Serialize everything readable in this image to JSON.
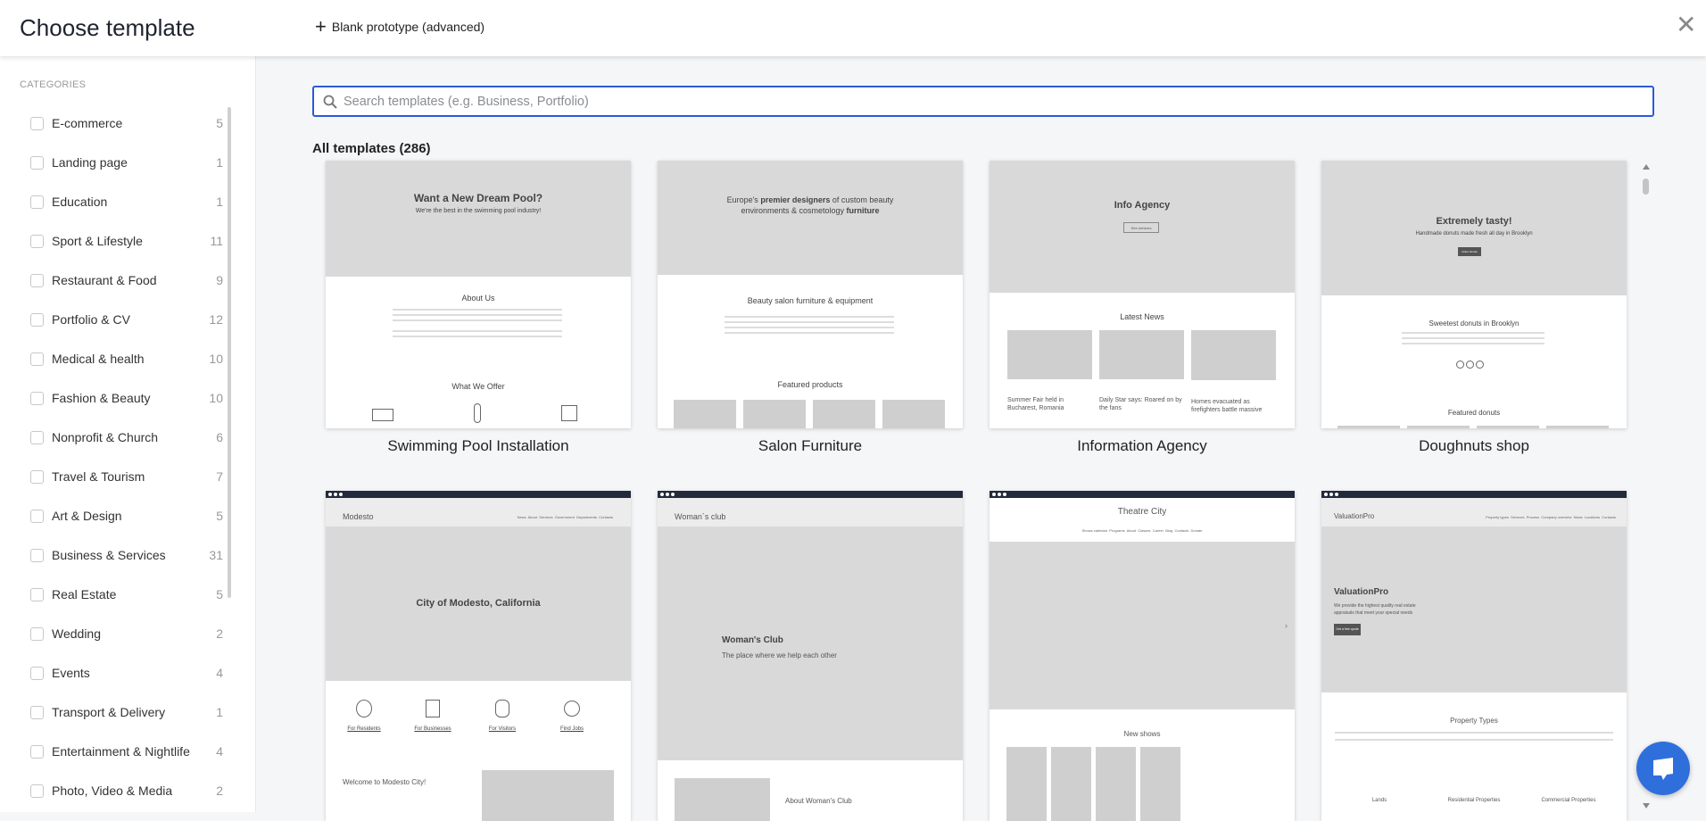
{
  "header": {
    "title": "Choose template",
    "blank_label": "Blank prototype (advanced)",
    "close_icon": "close-icon"
  },
  "sidebar": {
    "heading": "CATEGORIES",
    "items": [
      {
        "label": "E-commerce",
        "count": "5"
      },
      {
        "label": "Landing page",
        "count": "1"
      },
      {
        "label": "Education",
        "count": "1"
      },
      {
        "label": "Sport & Lifestyle",
        "count": "11"
      },
      {
        "label": "Restaurant & Food",
        "count": "9"
      },
      {
        "label": "Portfolio & CV",
        "count": "12"
      },
      {
        "label": "Medical & health",
        "count": "10"
      },
      {
        "label": "Fashion & Beauty",
        "count": "10"
      },
      {
        "label": "Nonprofit & Church",
        "count": "6"
      },
      {
        "label": "Travel & Tourism",
        "count": "7"
      },
      {
        "label": "Art & Design",
        "count": "5"
      },
      {
        "label": "Business & Services",
        "count": "31"
      },
      {
        "label": "Real Estate",
        "count": "5"
      },
      {
        "label": "Wedding",
        "count": "2"
      },
      {
        "label": "Events",
        "count": "4"
      },
      {
        "label": "Transport & Delivery",
        "count": "1"
      },
      {
        "label": "Entertainment & Nightlife",
        "count": "4"
      },
      {
        "label": "Photo, Video & Media",
        "count": "2"
      }
    ]
  },
  "search": {
    "placeholder": "Search templates (e.g. Business, Portfolio)",
    "value": ""
  },
  "main": {
    "heading": "All templates (286)"
  },
  "templates": [
    {
      "name": "Swimming Pool Installation",
      "hero": "Want a New Dream Pool?",
      "sub": "We're the best in the swimming pool industry!",
      "s1": "About Us",
      "s2": "What We Offer"
    },
    {
      "name": "Salon Furniture",
      "hero_a": "Europe's",
      "hero_b": "premier designers",
      "hero_c": "of custom beauty environments & cosmetology",
      "hero_d": "furniture",
      "s1": "Beauty salon furniture & equipment",
      "s2": "Featured products"
    },
    {
      "name": "Information Agency",
      "hero": "Info Agency",
      "btn": "See services",
      "s1": "Latest News",
      "news": [
        "Summer Fair held in Bucharest, Romania",
        "Daily Star says: Roared on by the fans",
        "Homes evacuated as firefighters battle massive"
      ]
    },
    {
      "name": "Doughnuts shop",
      "hero": "Extremely tasty!",
      "sub": "Handmade donuts made fresh all day in Brooklyn",
      "btn": "Order donuts",
      "s1": "Sweetest donuts in Brooklyn",
      "s2": "Featured donuts"
    },
    {
      "brand": "Modesto",
      "hero": "City of Modesto, California",
      "nav": "News  About  Services  Government  Departments  Contacts",
      "links": [
        "For Residents",
        "For Businesses",
        "For Visitors",
        "Find Jobs"
      ],
      "s1": "Welcome to Modesto City!"
    },
    {
      "brand": "Woman`s club",
      "hero": "Woman's Club",
      "sub": "The place where we help each other",
      "s1": "About Woman's Club"
    },
    {
      "brand": "Theatre City",
      "nav": "Shows calendar  Programs  About  Classes  Career  Blog  Contacts  Donate",
      "s1": "New shows"
    },
    {
      "brand": "ValuationPro",
      "hero": "ValuationPro",
      "sub": "We provide the highest quality real estate appraisals that meet your special needs",
      "btn": "Get a free quote",
      "nav": "Property types  Services  Process  Company overview  News  Locations  Contacts",
      "s1": "Property Types",
      "features": [
        "Lands",
        "Residential Properties",
        "Commercial Properties"
      ]
    }
  ],
  "colors": {
    "accent": "#2a5bd7",
    "chat": "#2f6fdc",
    "bar": "#232a3b"
  }
}
